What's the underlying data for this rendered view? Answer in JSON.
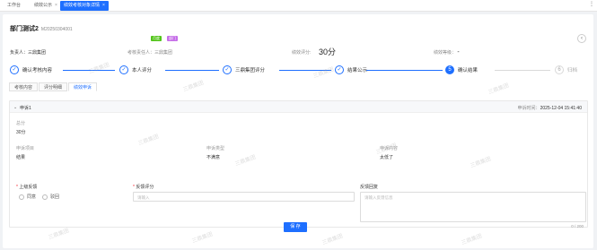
{
  "tabs": [
    {
      "label": "工作台"
    },
    {
      "label": "绩效公示"
    },
    {
      "label": "绩效考核对象详情"
    }
  ],
  "tabbar_more": "⋮",
  "header": {
    "title": "部门测试2",
    "code": "M20250304001",
    "badges": [
      "月度",
      "部门"
    ],
    "owner_label": "负责人：",
    "owner": "三鼎集团",
    "assessor_label": "考核责任人：",
    "assessor": "三鼎集团",
    "score_label": "绩效评分:",
    "score": "30分",
    "grade_label": "绩效等级：",
    "grade": "-"
  },
  "steps": [
    {
      "num": "✓",
      "label": "确认考核内容",
      "state": "done"
    },
    {
      "num": "✓",
      "label": "本人评分",
      "state": "done"
    },
    {
      "num": "✓",
      "label": "三鼎集团评分",
      "state": "done"
    },
    {
      "num": "✓",
      "label": "结果公示",
      "state": "done"
    },
    {
      "num": "5",
      "label": "确认结果",
      "state": "current"
    },
    {
      "num": "6",
      "label": "归档",
      "state": "todo"
    }
  ],
  "subtabs": [
    {
      "label": "考核内容"
    },
    {
      "label": "评分明细"
    },
    {
      "label": "绩效申诉"
    }
  ],
  "appeal": {
    "name": "申诉1",
    "time_label": "申诉时间：",
    "time": "2025-12-04 15:41:40",
    "total_label": "总分",
    "total": "30分",
    "item_label": "申诉项目",
    "item": "结果",
    "type_label": "申诉类型",
    "type": "不满意",
    "content_label": "申诉内容",
    "content": "太低了"
  },
  "form": {
    "superior_label": "上级反馈",
    "options": [
      "同意",
      "驳回"
    ],
    "rating_label": "反馈评分",
    "rating_placeholder": "请输入",
    "reply_label": "反馈回复",
    "reply_placeholder": "请输入反馈信息",
    "counter": "0 / 200",
    "save": "保 存"
  },
  "watermark": "三鼎集团",
  "colors": {
    "primary": "#1e6fff",
    "green": "#52c41a",
    "purple": "#c66fe8"
  }
}
